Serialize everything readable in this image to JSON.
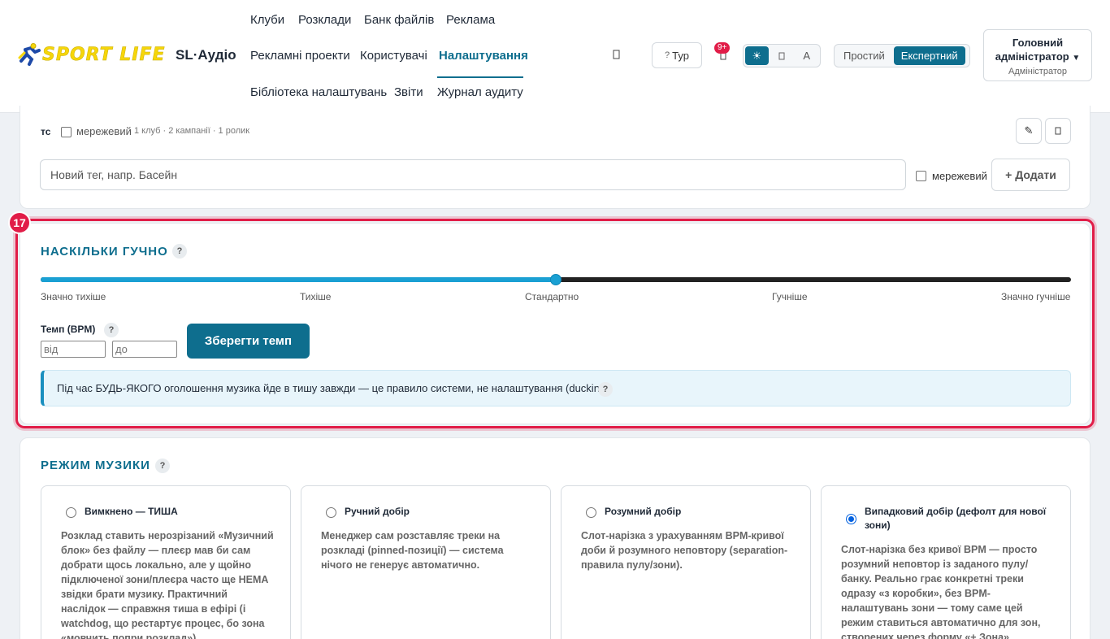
{
  "header": {
    "logo_text": "SPORT LIFE",
    "app_name": "SL·Аудіо",
    "nav_row1": [
      "Клуби",
      "Розклади",
      "Банк файлів",
      "Реклама"
    ],
    "nav_row2": [
      "Рекламні проекти",
      "Користувачі",
      "Налаштування"
    ],
    "nav_row3": [
      "Бібліотека налаштувань",
      "Звіти",
      "Журнал аудиту"
    ],
    "active_nav": "Налаштування",
    "search_icon": "search-icon",
    "tour_label": "Тур",
    "notifications_badge": "9+",
    "theme_options": [
      "☀",
      "",
      "A"
    ],
    "theme_selected": "light",
    "mode_options": [
      "Простий",
      "Експертний"
    ],
    "mode_selected": "Експертний",
    "user": {
      "name": "Головний адміністратор",
      "caret": "▼",
      "role": "Адміністратор"
    }
  },
  "tags_card": {
    "tag": {
      "name": "тс",
      "network_label": "мережевий",
      "meta": "1 клуб · 2 кампанії · 1 ролик"
    },
    "new_tag_placeholder": "Новий тег, напр. Басейн",
    "network_label": "мережевий",
    "add_label": "+ Додати",
    "edit_icon": "✎"
  },
  "loudness": {
    "step_number": "17",
    "title": "НАСКІЛЬКИ ГУЧНО",
    "help": "?",
    "slider_value_fraction": 0.5,
    "slider_labels": [
      "Значно тихіше",
      "Тихіше",
      "Стандартно",
      "Гучніше",
      "Значно гучніше"
    ],
    "tempo_label": "Темп (BPM)",
    "tempo_from_placeholder": "від",
    "tempo_to_placeholder": "до",
    "save_tempo_label": "Зберегти темп",
    "info_text": "Під час БУДЬ-ЯКОГО оголошення музика йде в тишу завжди — це правило системи, не налаштування (ducking)."
  },
  "music_mode": {
    "title": "РЕЖИМ МУЗИКИ",
    "help": "?",
    "selected_index": 3,
    "options": [
      {
        "title": "Вимкнено — ТИША",
        "desc": "Розклад ставить нерозрізаний «Музичний блок» без файлу — плеєр мав би сам добрати щось локально, але у щойно підключеної зони/плеєра часто ще НЕМА звідки брати музику. Практичний наслідок — справжня тиша в ефірі (і watchdog, що рестартує процес, бо зона «мовчить попри розклад»)."
      },
      {
        "title": "Ручний добір",
        "desc": "Менеджер сам розставляє треки на розкладі (pinned-позиції) — система нічого не генерує автоматично."
      },
      {
        "title": "Розумний добір",
        "desc": "Слот-нарізка з урахуванням BPM-кривої доби й розумного неповтору (separation-правила пулу/зони)."
      },
      {
        "title": "Випадковий добір (дефолт для нової зони)",
        "desc": "Слот-нарізка без кривої BPM — просто розумний неповтор із заданого пулу/банку. Реально грає конкретні треки одразу «з коробки», без BPM-налаштувань зони — тому саме цей режим ставиться автоматично для зон, створених через форму «+ Зона»."
      }
    ]
  },
  "colors": {
    "accent": "#0e6e8e",
    "highlight": "#e11d48",
    "slider": "#1aa0d3",
    "logo": "#f6d60a"
  }
}
